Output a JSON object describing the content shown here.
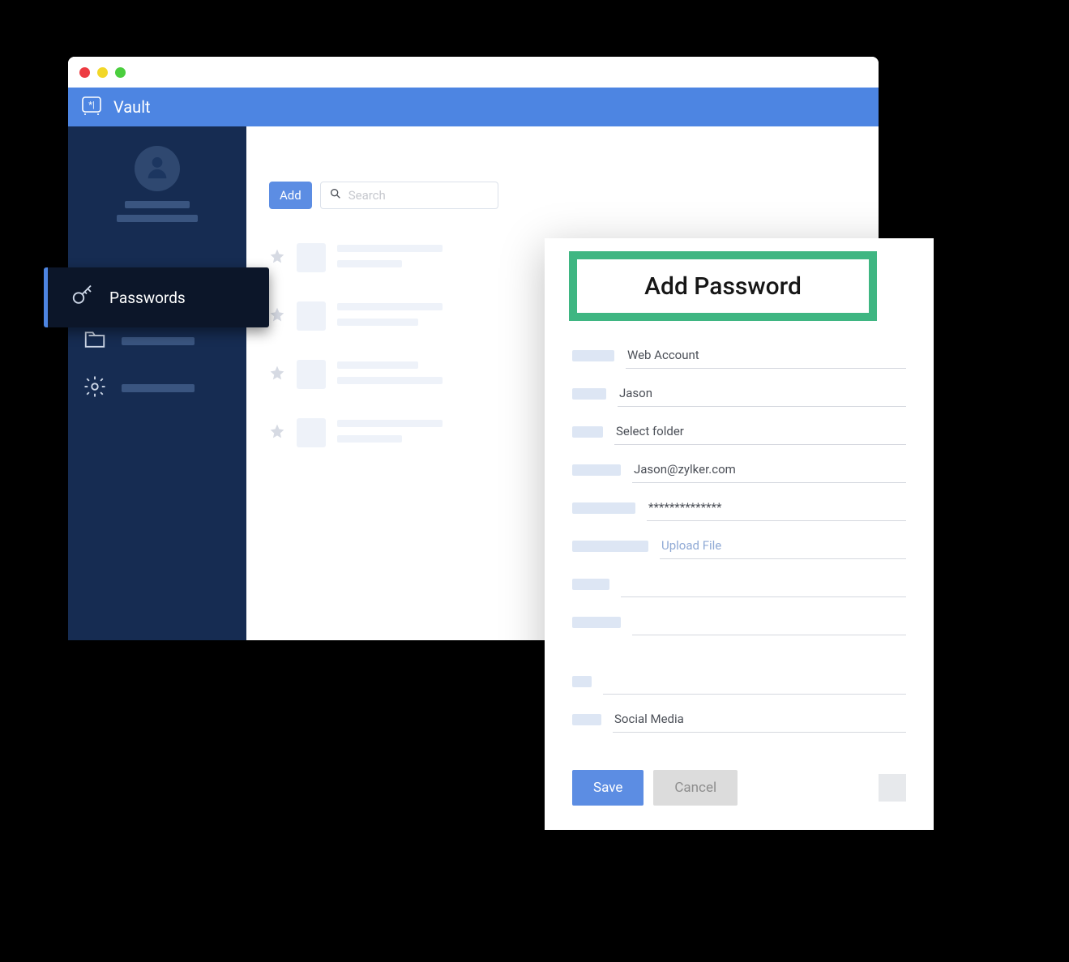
{
  "app": {
    "name": "Vault"
  },
  "sidebar": {
    "active_label": "Passwords"
  },
  "toolbar": {
    "add_label": "Add"
  },
  "search": {
    "placeholder": "Search"
  },
  "modal": {
    "title": "Add Password",
    "fields": {
      "account_type": "Web Account",
      "name": "Jason",
      "folder": "Select folder",
      "email": "Jason@zylker.com",
      "password": "**************",
      "upload": "Upload File",
      "blank1": "",
      "blank2": "",
      "blank3": "",
      "category": "Social Media"
    },
    "buttons": {
      "save": "Save",
      "cancel": "Cancel"
    }
  },
  "colors": {
    "brand": "#4d85e2",
    "sidebar": "#162c52",
    "accent": "#3fb682"
  }
}
